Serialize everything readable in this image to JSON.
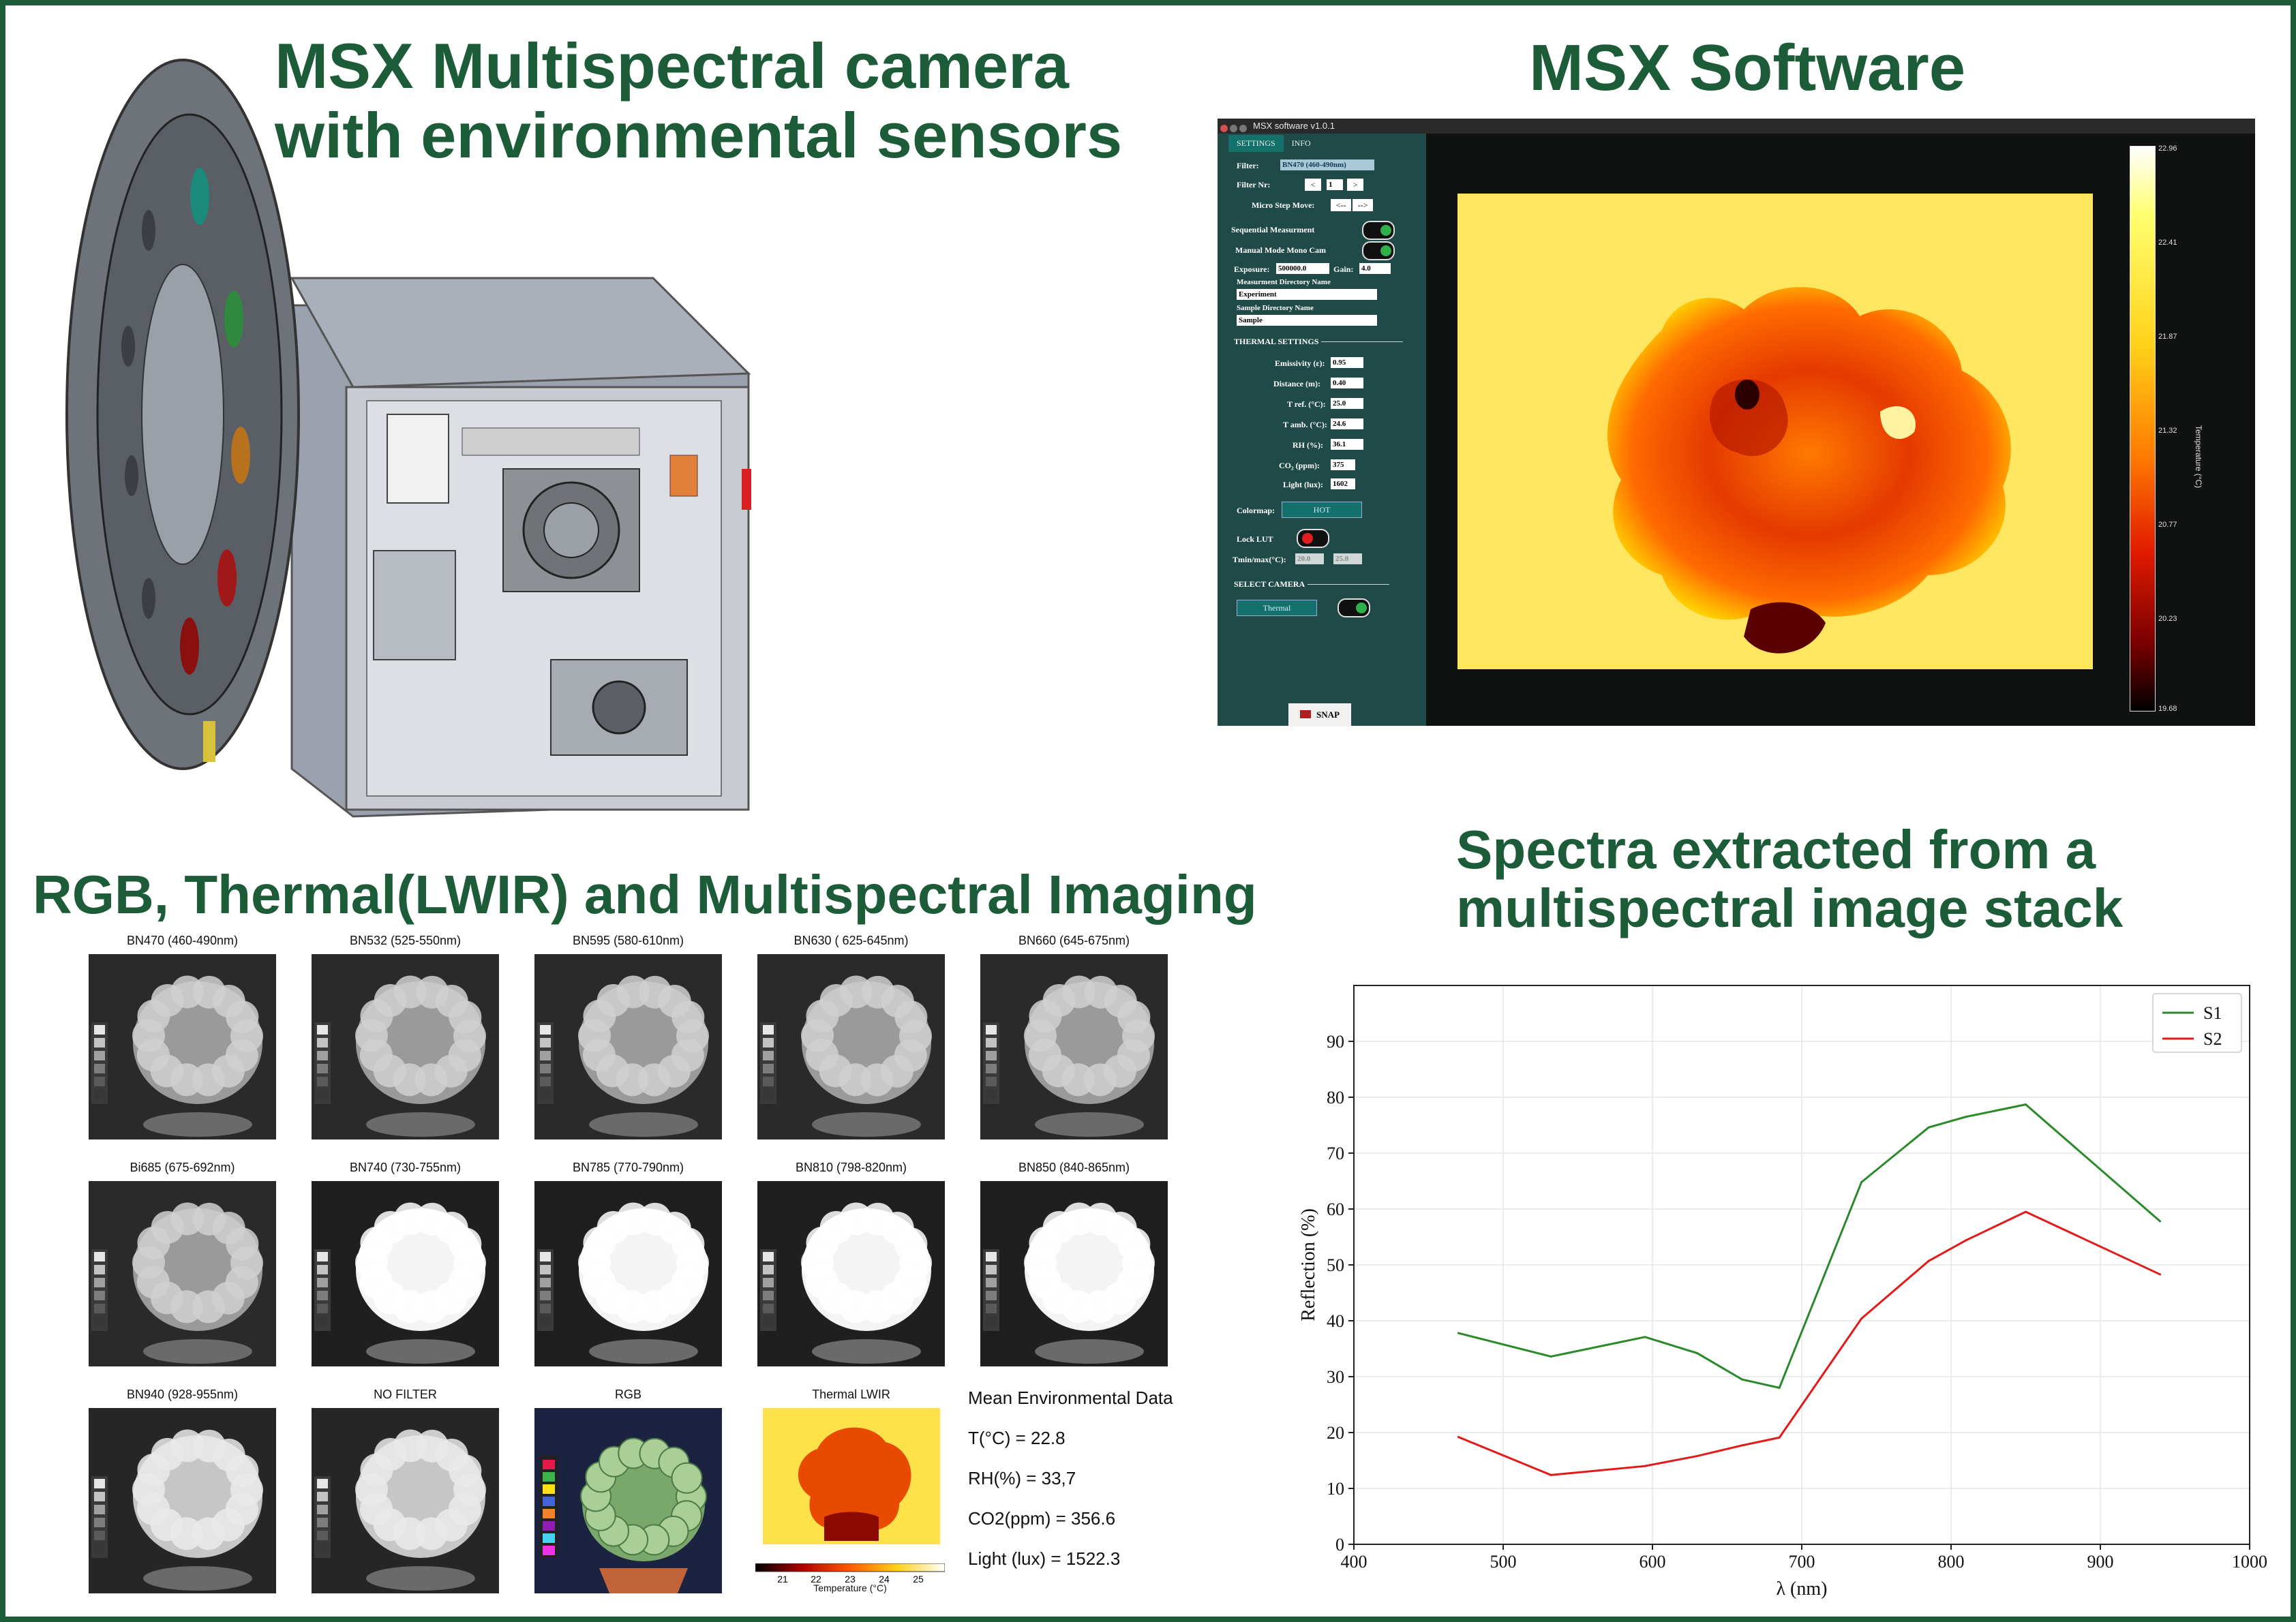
{
  "headings": {
    "camera": [
      "MSX Multispectral camera",
      "with environmental sensors"
    ],
    "software": "MSX Software",
    "imaging": "RGB, Thermal(LWIR) and Multispectral Imaging",
    "spectra": [
      "Spectra extracted from a",
      "multispectral image stack"
    ]
  },
  "colors": {
    "accent": "#1d5c38",
    "series_s1": "#2a8a2a",
    "series_s2": "#e41a1a"
  },
  "software": {
    "window_title": "MSX software v1.0.1",
    "tabs": [
      "SETTINGS",
      "INFO"
    ],
    "filter_label": "Filter:",
    "filter_value": "BN470 (460-490nm)",
    "filter_nr_label": "Filter Nr:",
    "filter_nr_prev": "<",
    "filter_nr_value": "1",
    "filter_nr_next": ">",
    "micro_step_label": "Micro Step Move:",
    "micro_step_back": "<--",
    "micro_step_fwd": "-->",
    "sequential_label": "Sequential Measurment",
    "manual_mode_label": "Manual Mode Mono Cam",
    "exposure_label": "Exposure:",
    "exposure_value": "500000.0",
    "gain_label": "Gain:",
    "gain_value": "4.0",
    "measurement_dir_label": "Measurment Directory Name",
    "measurement_dir_value": "Experiment",
    "sample_dir_label": "Sample Directory Name",
    "sample_dir_value": "Sample",
    "thermal_settings_title": "THERMAL SETTINGS",
    "emissivity_label": "Emissivity (ε):",
    "emissivity_value": "0.95",
    "distance_label": "Distance (m):",
    "distance_value": "0.40",
    "tref_label": "T ref. (°C):",
    "tref_value": "25.0",
    "tamb_label": "T amb. (°C):",
    "tamb_value": "24.6",
    "rh_label": "RH (%):",
    "rh_value": "36.1",
    "co2_label": "CO₂ (ppm):",
    "co2_value": "375",
    "light_label": "Light (lux):",
    "light_value": "1602",
    "colormap_label": "Colormap:",
    "colormap_value": "HOT",
    "lock_lut_label": "Lock LUT",
    "tminmax_label": "Tmin/max(°C):",
    "tmin_value": "20.0",
    "tmax_value": "25.0",
    "select_camera_title": "SELECT CAMERA",
    "camera_value": "Thermal",
    "snap_label": "SNAP",
    "colorbar_label": "Temperature (°C)",
    "colorbar_ticks": [
      "22.96",
      "22.41",
      "21.87",
      "21.32",
      "20.77",
      "20.23",
      "19.68"
    ]
  },
  "imaging": {
    "panels": [
      {
        "label": "BN470 (460-490nm)",
        "kind": "gray-dark"
      },
      {
        "label": "BN532 (525-550nm)",
        "kind": "gray-dark"
      },
      {
        "label": "BN595 (580-610nm)",
        "kind": "gray-dark"
      },
      {
        "label": "BN630 ( 625-645nm)",
        "kind": "gray-dark"
      },
      {
        "label": "BN660 (645-675nm)",
        "kind": "gray-dark"
      },
      {
        "label": "Bi685 (675-692nm)",
        "kind": "gray-dark"
      },
      {
        "label": "BN740 (730-755nm)",
        "kind": "gray-bright"
      },
      {
        "label": "BN785 (770-790nm)",
        "kind": "gray-bright"
      },
      {
        "label": "BN810 (798-820nm)",
        "kind": "gray-bright"
      },
      {
        "label": "BN850 (840-865nm)",
        "kind": "gray-bright"
      },
      {
        "label": "BN940 (928-955nm)",
        "kind": "gray-mid"
      },
      {
        "label": "NO FILTER",
        "kind": "gray-mid"
      },
      {
        "label": "RGB",
        "kind": "rgb"
      },
      {
        "label": "Thermal LWIR",
        "kind": "thermal"
      }
    ],
    "thermal_scale_ticks": [
      "21",
      "22",
      "23",
      "24",
      "25"
    ],
    "thermal_scale_title": "Temperature (°C)",
    "environment": {
      "title": "Mean Environmental Data",
      "temperature": "T(°C) = 22.8",
      "humidity": "RH(%) = 33,7",
      "co2": "CO2(ppm) = 356.6",
      "light": "Light (lux) = 1522.3"
    }
  },
  "chart_data": {
    "type": "line",
    "title": "",
    "xlabel": "λ (nm)",
    "ylabel": "Reflection (%)",
    "xlim": [
      400,
      1000
    ],
    "ylim": [
      0,
      100
    ],
    "xticks": [
      400,
      500,
      600,
      700,
      800,
      900,
      1000
    ],
    "yticks": [
      0,
      10,
      20,
      30,
      40,
      50,
      60,
      70,
      80,
      90
    ],
    "grid": true,
    "legend": "top-right",
    "series": [
      {
        "name": "S1",
        "color": "#2a8a2a",
        "x": [
          470,
          532,
          595,
          630,
          660,
          685,
          740,
          785,
          810,
          850,
          940
        ],
        "y": [
          37.8,
          33.6,
          37.1,
          34.2,
          29.5,
          28.0,
          64.8,
          74.6,
          76.5,
          78.7,
          57.8
        ]
      },
      {
        "name": "S2",
        "color": "#e41a1a",
        "x": [
          470,
          532,
          595,
          630,
          660,
          685,
          740,
          785,
          810,
          850,
          940
        ],
        "y": [
          19.2,
          12.4,
          14.0,
          15.8,
          17.7,
          19.1,
          40.4,
          50.7,
          54.4,
          59.5,
          48.3
        ]
      }
    ]
  }
}
